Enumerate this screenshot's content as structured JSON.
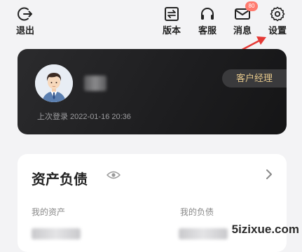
{
  "topbar": {
    "logout_label": "退出",
    "version_label": "版本",
    "service_label": "客服",
    "messages_label": "消息",
    "messages_badge": "80",
    "settings_label": "设置"
  },
  "profile": {
    "manager_label": "客户经理",
    "last_login": "上次登录 2022-01-16 20:36"
  },
  "assets": {
    "title": "资产负债",
    "my_assets_label": "我的资产",
    "my_liabilities_label": "我的负债"
  },
  "watermark": "5izixue.com",
  "colors": {
    "card_dark": "#1d1d1f",
    "manager_text": "#e7c98c",
    "arrow_red": "#e53935",
    "badge": "#ff7a6e"
  }
}
